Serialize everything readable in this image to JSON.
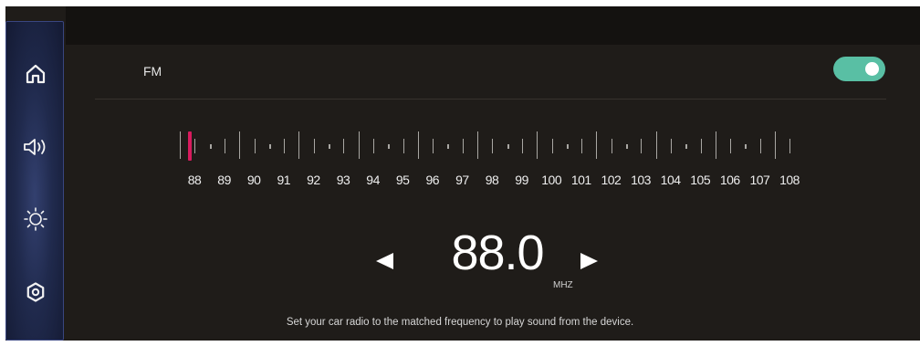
{
  "sidebar": {
    "items": [
      {
        "icon": "home-icon"
      },
      {
        "icon": "volume-icon"
      },
      {
        "icon": "brightness-icon"
      },
      {
        "icon": "settings-icon"
      }
    ]
  },
  "header": {
    "band_label": "FM",
    "toggle_on": true,
    "toggle_color": "#59bfa4"
  },
  "tuner": {
    "scale_labels": [
      "88",
      "89",
      "90",
      "91",
      "92",
      "93",
      "94",
      "95",
      "96",
      "97",
      "98",
      "99",
      "100",
      "101",
      "102",
      "103",
      "104",
      "105",
      "106",
      "107",
      "108"
    ],
    "selected_frequency": 88.0,
    "marker_color": "#d81b5e",
    "frequency_display": "88.0",
    "unit": "MHZ"
  },
  "hint": "Set your car radio to the matched frequency to play sound from the device."
}
